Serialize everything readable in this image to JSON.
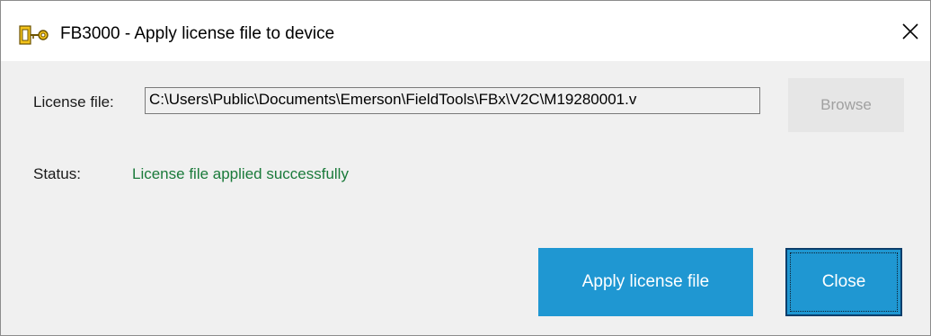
{
  "window": {
    "title": "FB3000 - Apply license file to device",
    "icon": "key-icon",
    "close_icon": "close-icon"
  },
  "form": {
    "license_file_label": "License file:",
    "license_file_value": "C:\\Users\\Public\\Documents\\Emerson\\FieldTools\\FBx\\V2C\\M19280001.v",
    "browse_label": "Browse",
    "status_label": "Status:",
    "status_value": "License file applied successfully"
  },
  "buttons": {
    "apply_label": "Apply license file",
    "close_label": "Close"
  },
  "colors": {
    "accent": "#1f97d2",
    "status_success": "#1a7a3a",
    "disabled_text": "#a0a0a0"
  }
}
